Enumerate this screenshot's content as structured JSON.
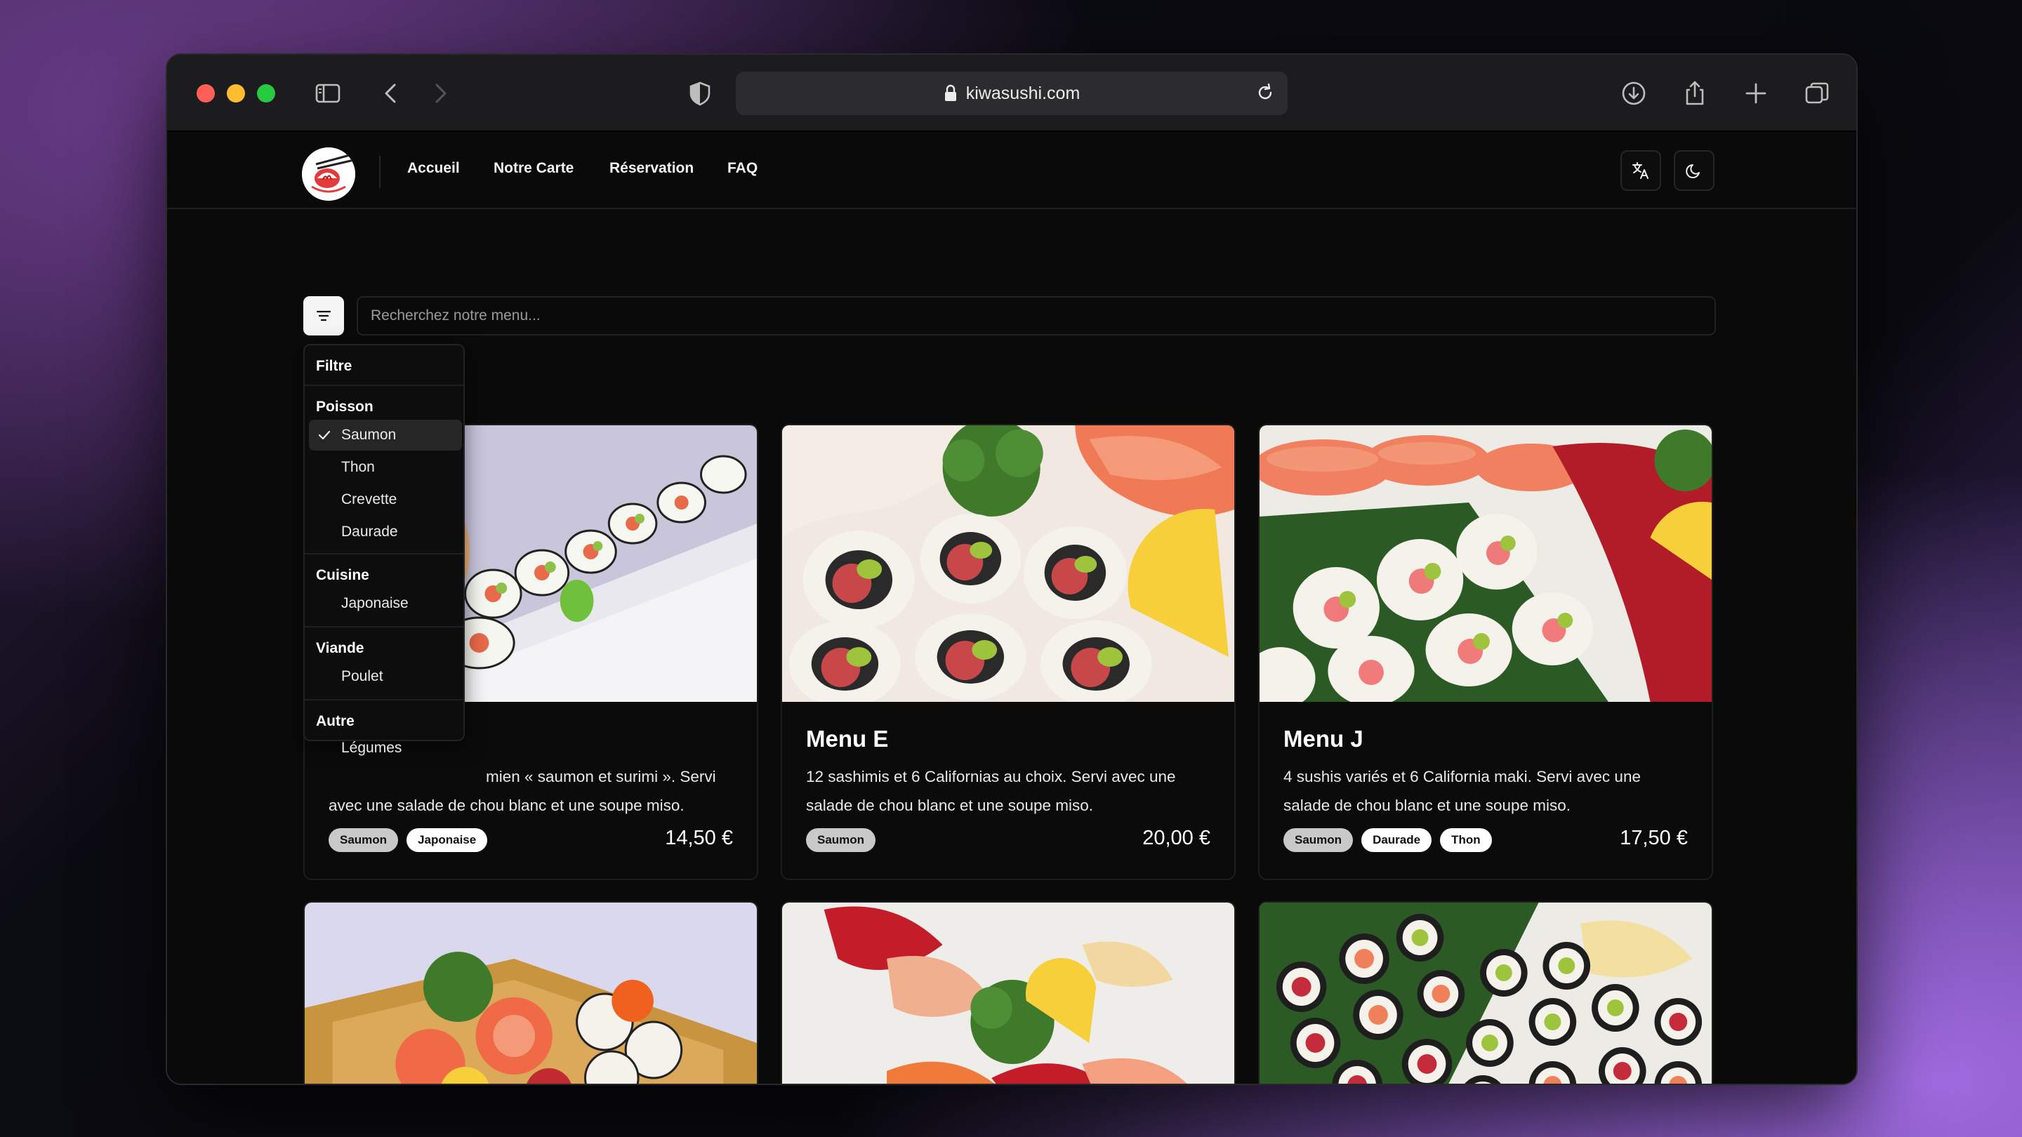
{
  "browser": {
    "url": "kiwasushi.com"
  },
  "nav": {
    "links": [
      "Accueil",
      "Notre Carte",
      "Réservation",
      "FAQ"
    ]
  },
  "search": {
    "placeholder": "Recherchez notre menu..."
  },
  "filter": {
    "title": "Filtre",
    "groups": [
      {
        "label": "Poisson",
        "items": [
          {
            "label": "Saumon",
            "checked": true
          },
          {
            "label": "Thon",
            "checked": false
          },
          {
            "label": "Crevette",
            "checked": false
          },
          {
            "label": "Daurade",
            "checked": false
          }
        ]
      },
      {
        "label": "Cuisine",
        "items": [
          {
            "label": "Japonaise",
            "checked": false
          }
        ]
      },
      {
        "label": "Viande",
        "items": [
          {
            "label": "Poulet",
            "checked": false
          }
        ]
      },
      {
        "label": "Autre",
        "items": [
          {
            "label": "Légumes",
            "checked": false
          }
        ]
      }
    ]
  },
  "cards": [
    {
      "title": "",
      "desc_line1": "mien « saumon et surimi ». Servi",
      "desc_line2": "avec une salade de chou blanc et une soupe miso.",
      "tags": [
        "Saumon",
        "Japonaise"
      ],
      "price": "14,50 €"
    },
    {
      "title": "Menu E",
      "desc_line1": "12 sashimis et 6 Californias au choix. Servi avec une",
      "desc_line2": "salade de chou blanc et une soupe miso.",
      "tags": [
        "Saumon"
      ],
      "price": "20,00 €"
    },
    {
      "title": "Menu J",
      "desc_line1": "4 sushis variés et 6 California maki. Servi avec une",
      "desc_line2": "salade de chou blanc et une soupe miso.",
      "tags": [
        "Saumon",
        "Daurade",
        "Thon"
      ],
      "price": "17,50 €"
    }
  ],
  "colors": {
    "accent": "#ffffff",
    "background": "#0a0a0a",
    "tag_primary": "#c9c9c9"
  }
}
